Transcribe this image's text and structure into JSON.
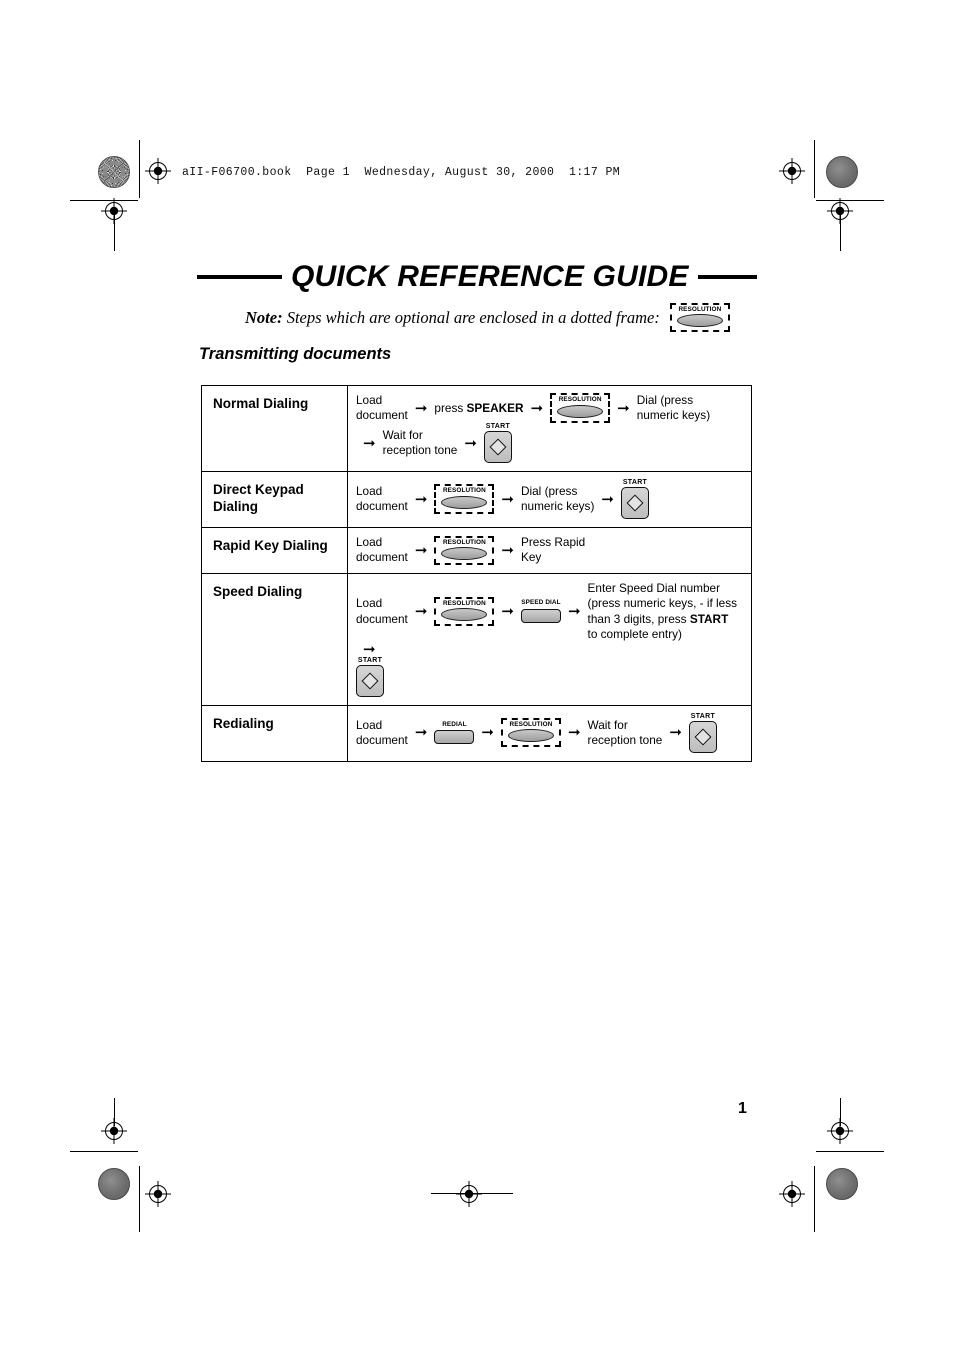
{
  "page": {
    "file_meta": "aII-F06700.book  Page 1  Wednesday, August 30, 2000  1:17 PM",
    "title": "QUICK REFERENCE GUIDE",
    "page_number": "1"
  },
  "note": {
    "label": "Note:",
    "text": " Steps which are optional are enclosed in a dotted frame:",
    "key": {
      "caption": "RESOLUTION"
    }
  },
  "section": {
    "heading": "Transmitting documents"
  },
  "keys": {
    "resolution": "RESOLUTION",
    "speed_dial": "SPEED DIAL",
    "redial": "REDIAL",
    "start": "START"
  },
  "arrow": "➞",
  "table": {
    "rows": [
      {
        "label": "Normal Dialing",
        "steps": [
          {
            "type": "text",
            "text": "Load\ndocument"
          },
          {
            "type": "arrow"
          },
          {
            "type": "rich",
            "pre": "press ",
            "strong": "SPEAKER",
            "post": ""
          },
          {
            "type": "arrow"
          },
          {
            "type": "key-resolution-dashed"
          },
          {
            "type": "arrow"
          },
          {
            "type": "text",
            "text": "Dial (press\nnumeric keys)"
          },
          {
            "type": "break"
          },
          {
            "type": "arrow"
          },
          {
            "type": "text",
            "text": "Wait for\nreception tone"
          },
          {
            "type": "arrow"
          },
          {
            "type": "key-start"
          }
        ]
      },
      {
        "label": "Direct Keypad\nDialing",
        "steps": [
          {
            "type": "text",
            "text": "Load\ndocument"
          },
          {
            "type": "arrow"
          },
          {
            "type": "key-resolution-dashed"
          },
          {
            "type": "arrow"
          },
          {
            "type": "text",
            "text": "Dial (press\nnumeric keys)"
          },
          {
            "type": "arrow"
          },
          {
            "type": "key-start"
          }
        ]
      },
      {
        "label": "Rapid Key Dialing",
        "steps": [
          {
            "type": "text",
            "text": "Load\ndocument"
          },
          {
            "type": "arrow"
          },
          {
            "type": "key-resolution-dashed"
          },
          {
            "type": "arrow"
          },
          {
            "type": "text",
            "text": "Press Rapid\nKey"
          }
        ]
      },
      {
        "label": "Speed Dialing",
        "steps": [
          {
            "type": "text",
            "text": "Load\ndocument"
          },
          {
            "type": "arrow"
          },
          {
            "type": "key-resolution-dashed"
          },
          {
            "type": "arrow"
          },
          {
            "type": "key-speed-dial"
          },
          {
            "type": "arrow"
          },
          {
            "type": "rich",
            "pre": "Enter Speed Dial number\n(press numeric keys, - if less\nthan 3 digits, press ",
            "strong": "START",
            "post": "\nto complete entry)"
          },
          {
            "type": "arrow"
          },
          {
            "type": "break"
          },
          {
            "type": "key-start"
          }
        ]
      },
      {
        "label": "Redialing",
        "steps": [
          {
            "type": "text",
            "text": "Load\ndocument"
          },
          {
            "type": "arrow"
          },
          {
            "type": "key-redial"
          },
          {
            "type": "arrow"
          },
          {
            "type": "key-resolution-dashed"
          },
          {
            "type": "arrow"
          },
          {
            "type": "text",
            "text": "Wait for\nreception tone"
          },
          {
            "type": "arrow"
          },
          {
            "type": "key-start"
          }
        ]
      }
    ]
  }
}
